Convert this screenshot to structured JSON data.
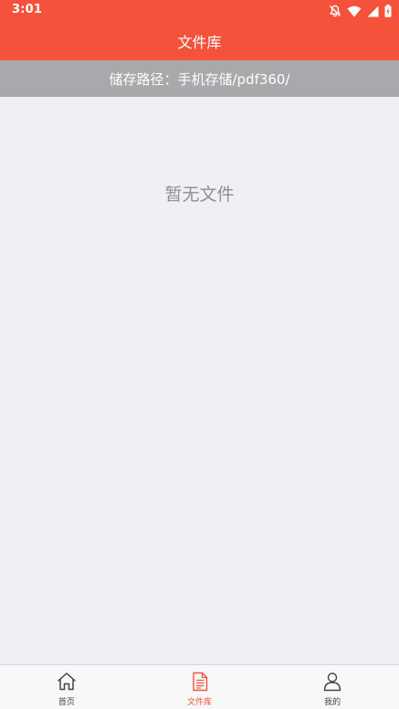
{
  "colors": {
    "accent": "#f4523b",
    "path_bar_bg": "#a9a9ab",
    "background": "#efeff4",
    "inactive_tab": "#444444"
  },
  "status_bar": {
    "time": "3:01",
    "icons": [
      "notifications-off-icon",
      "wifi-icon",
      "cellular-signal-icon",
      "battery-charging-icon"
    ]
  },
  "header": {
    "title": "文件库"
  },
  "path_bar": {
    "text": "储存路径：手机存储/pdf360/"
  },
  "content": {
    "empty_message": "暂无文件"
  },
  "tab_bar": {
    "active_tab": "文件库",
    "tabs": [
      {
        "label": "首页",
        "icon": "home-icon"
      },
      {
        "label": "文件库",
        "icon": "document-icon"
      },
      {
        "label": "我的",
        "icon": "user-icon"
      }
    ]
  }
}
